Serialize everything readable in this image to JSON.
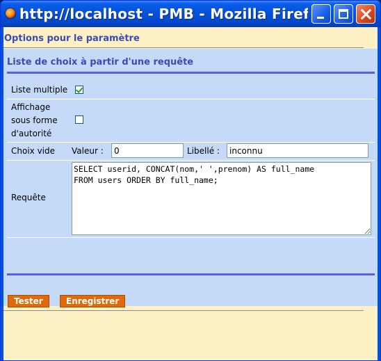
{
  "window": {
    "title": "http://localhost - PMB - Mozilla Firef..."
  },
  "page": {
    "title": "Options pour le paramètre"
  },
  "section": {
    "title": "Liste de choix à partir d'une requête"
  },
  "form": {
    "multiple_label": "Liste multiple",
    "multiple_checked": true,
    "authority_label_lines": [
      "Affichage",
      "sous forme",
      "d'autorité"
    ],
    "authority_checked": false,
    "empty_choice_label": "Choix vide",
    "value_label": "Valeur :",
    "value_input": "0",
    "libelle_label": "Libellé :",
    "libelle_input": "inconnu",
    "query_label": "Requête",
    "query_text": "SELECT userid, CONCAT(nom,' ',prenom) AS full_name\nFROM users ORDER BY full_name;"
  },
  "buttons": {
    "test": "Tester",
    "save": "Enregistrer"
  },
  "colors": {
    "title_blue": "#3a4bb8",
    "panel_bg": "#c5daf8",
    "page_bg": "#fdf0c4",
    "button_orange": "#e06a0a"
  }
}
